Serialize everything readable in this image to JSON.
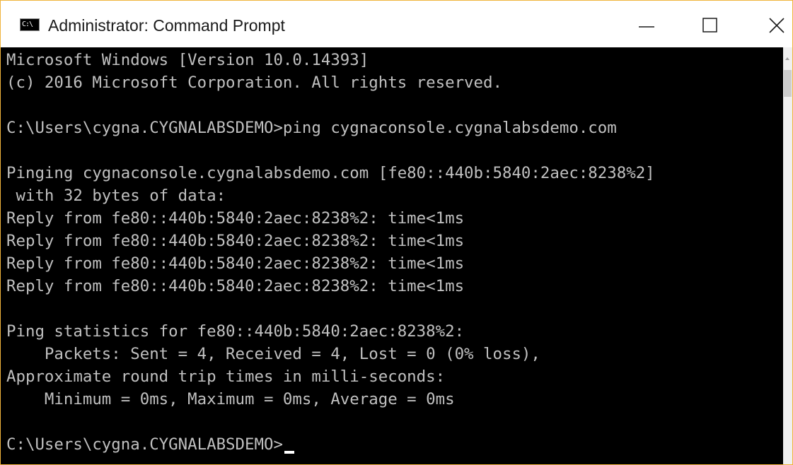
{
  "window": {
    "title": "Administrator: Command Prompt",
    "app_icon": "cmd-icon",
    "app_icon_glyph": "C:\\",
    "controls": {
      "minimize": "minimize-icon",
      "maximize": "maximize-icon",
      "close": "close-icon"
    },
    "border_color": "#f0b43c"
  },
  "console": {
    "background": "#000000",
    "foreground": "#c0c0c0",
    "lines": [
      "Microsoft Windows [Version 10.0.14393]",
      "(c) 2016 Microsoft Corporation. All rights reserved.",
      "",
      "C:\\Users\\cygna.CYGNALABSDEMO>ping cygnaconsole.cygnalabsdemo.com",
      "",
      "Pinging cygnaconsole.cygnalabsdemo.com [fe80::440b:5840:2aec:8238%2]",
      " with 32 bytes of data:",
      "Reply from fe80::440b:5840:2aec:8238%2: time<1ms",
      "Reply from fe80::440b:5840:2aec:8238%2: time<1ms",
      "Reply from fe80::440b:5840:2aec:8238%2: time<1ms",
      "Reply from fe80::440b:5840:2aec:8238%2: time<1ms",
      "",
      "Ping statistics for fe80::440b:5840:2aec:8238%2:",
      "    Packets: Sent = 4, Received = 4, Lost = 0 (0% loss),",
      "Approximate round trip times in milli-seconds:",
      "    Minimum = 0ms, Maximum = 0ms, Average = 0ms",
      "",
      "C:\\Users\\cygna.CYGNALABSDEMO>"
    ]
  }
}
